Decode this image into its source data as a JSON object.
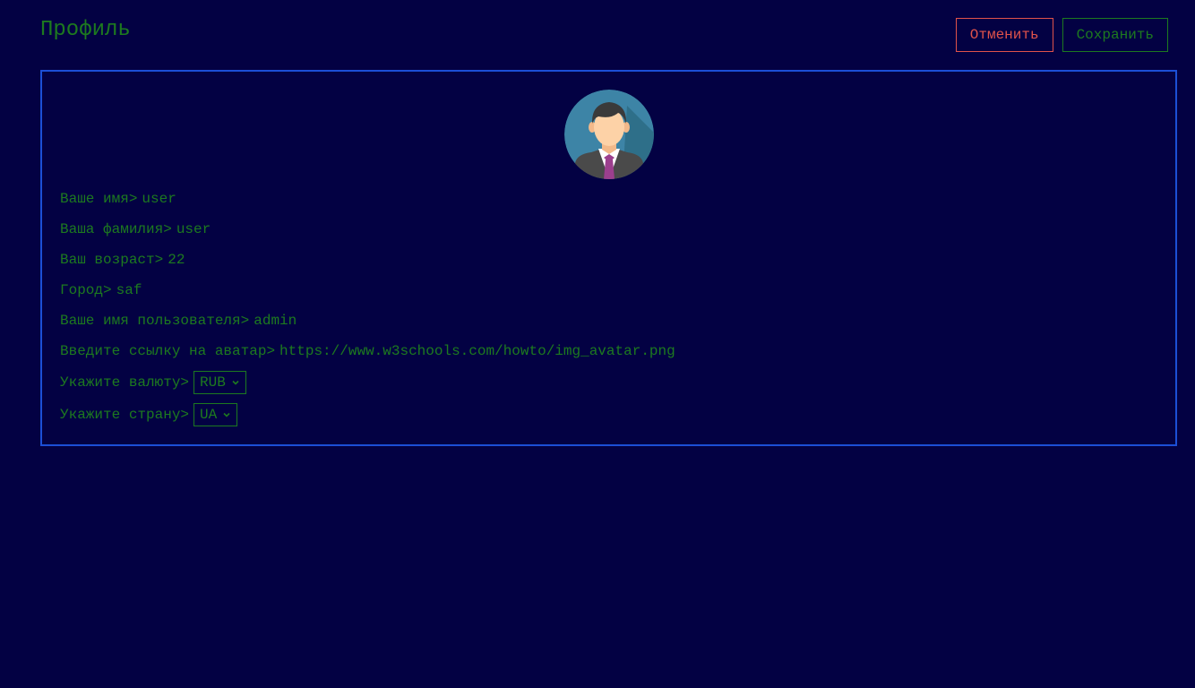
{
  "header": {
    "title": "Профиль"
  },
  "actions": {
    "cancel_label": "Отменить",
    "save_label": "Сохранить"
  },
  "profile": {
    "avatar_icon": "user-avatar-icon",
    "fields": [
      {
        "label": "Ваше имя>",
        "value": "user"
      },
      {
        "label": "Ваша фамилия>",
        "value": "user"
      },
      {
        "label": "Ваш возраст>",
        "value": "22"
      },
      {
        "label": "Город>",
        "value": "saf"
      },
      {
        "label": "Ваше имя пользователя>",
        "value": "admin"
      },
      {
        "label": "Введите ссылку на аватар>",
        "value": "https://www.w3schools.com/howto/img_avatar.png"
      }
    ],
    "currency": {
      "label": "Укажите валюту>",
      "selected": "RUB"
    },
    "country": {
      "label": "Укажите страну>",
      "selected": "UA"
    }
  },
  "colors": {
    "background": "#030143",
    "text": "#1d7a1f",
    "cancel": "#e0534b",
    "card_border": "#1c4fd6"
  }
}
